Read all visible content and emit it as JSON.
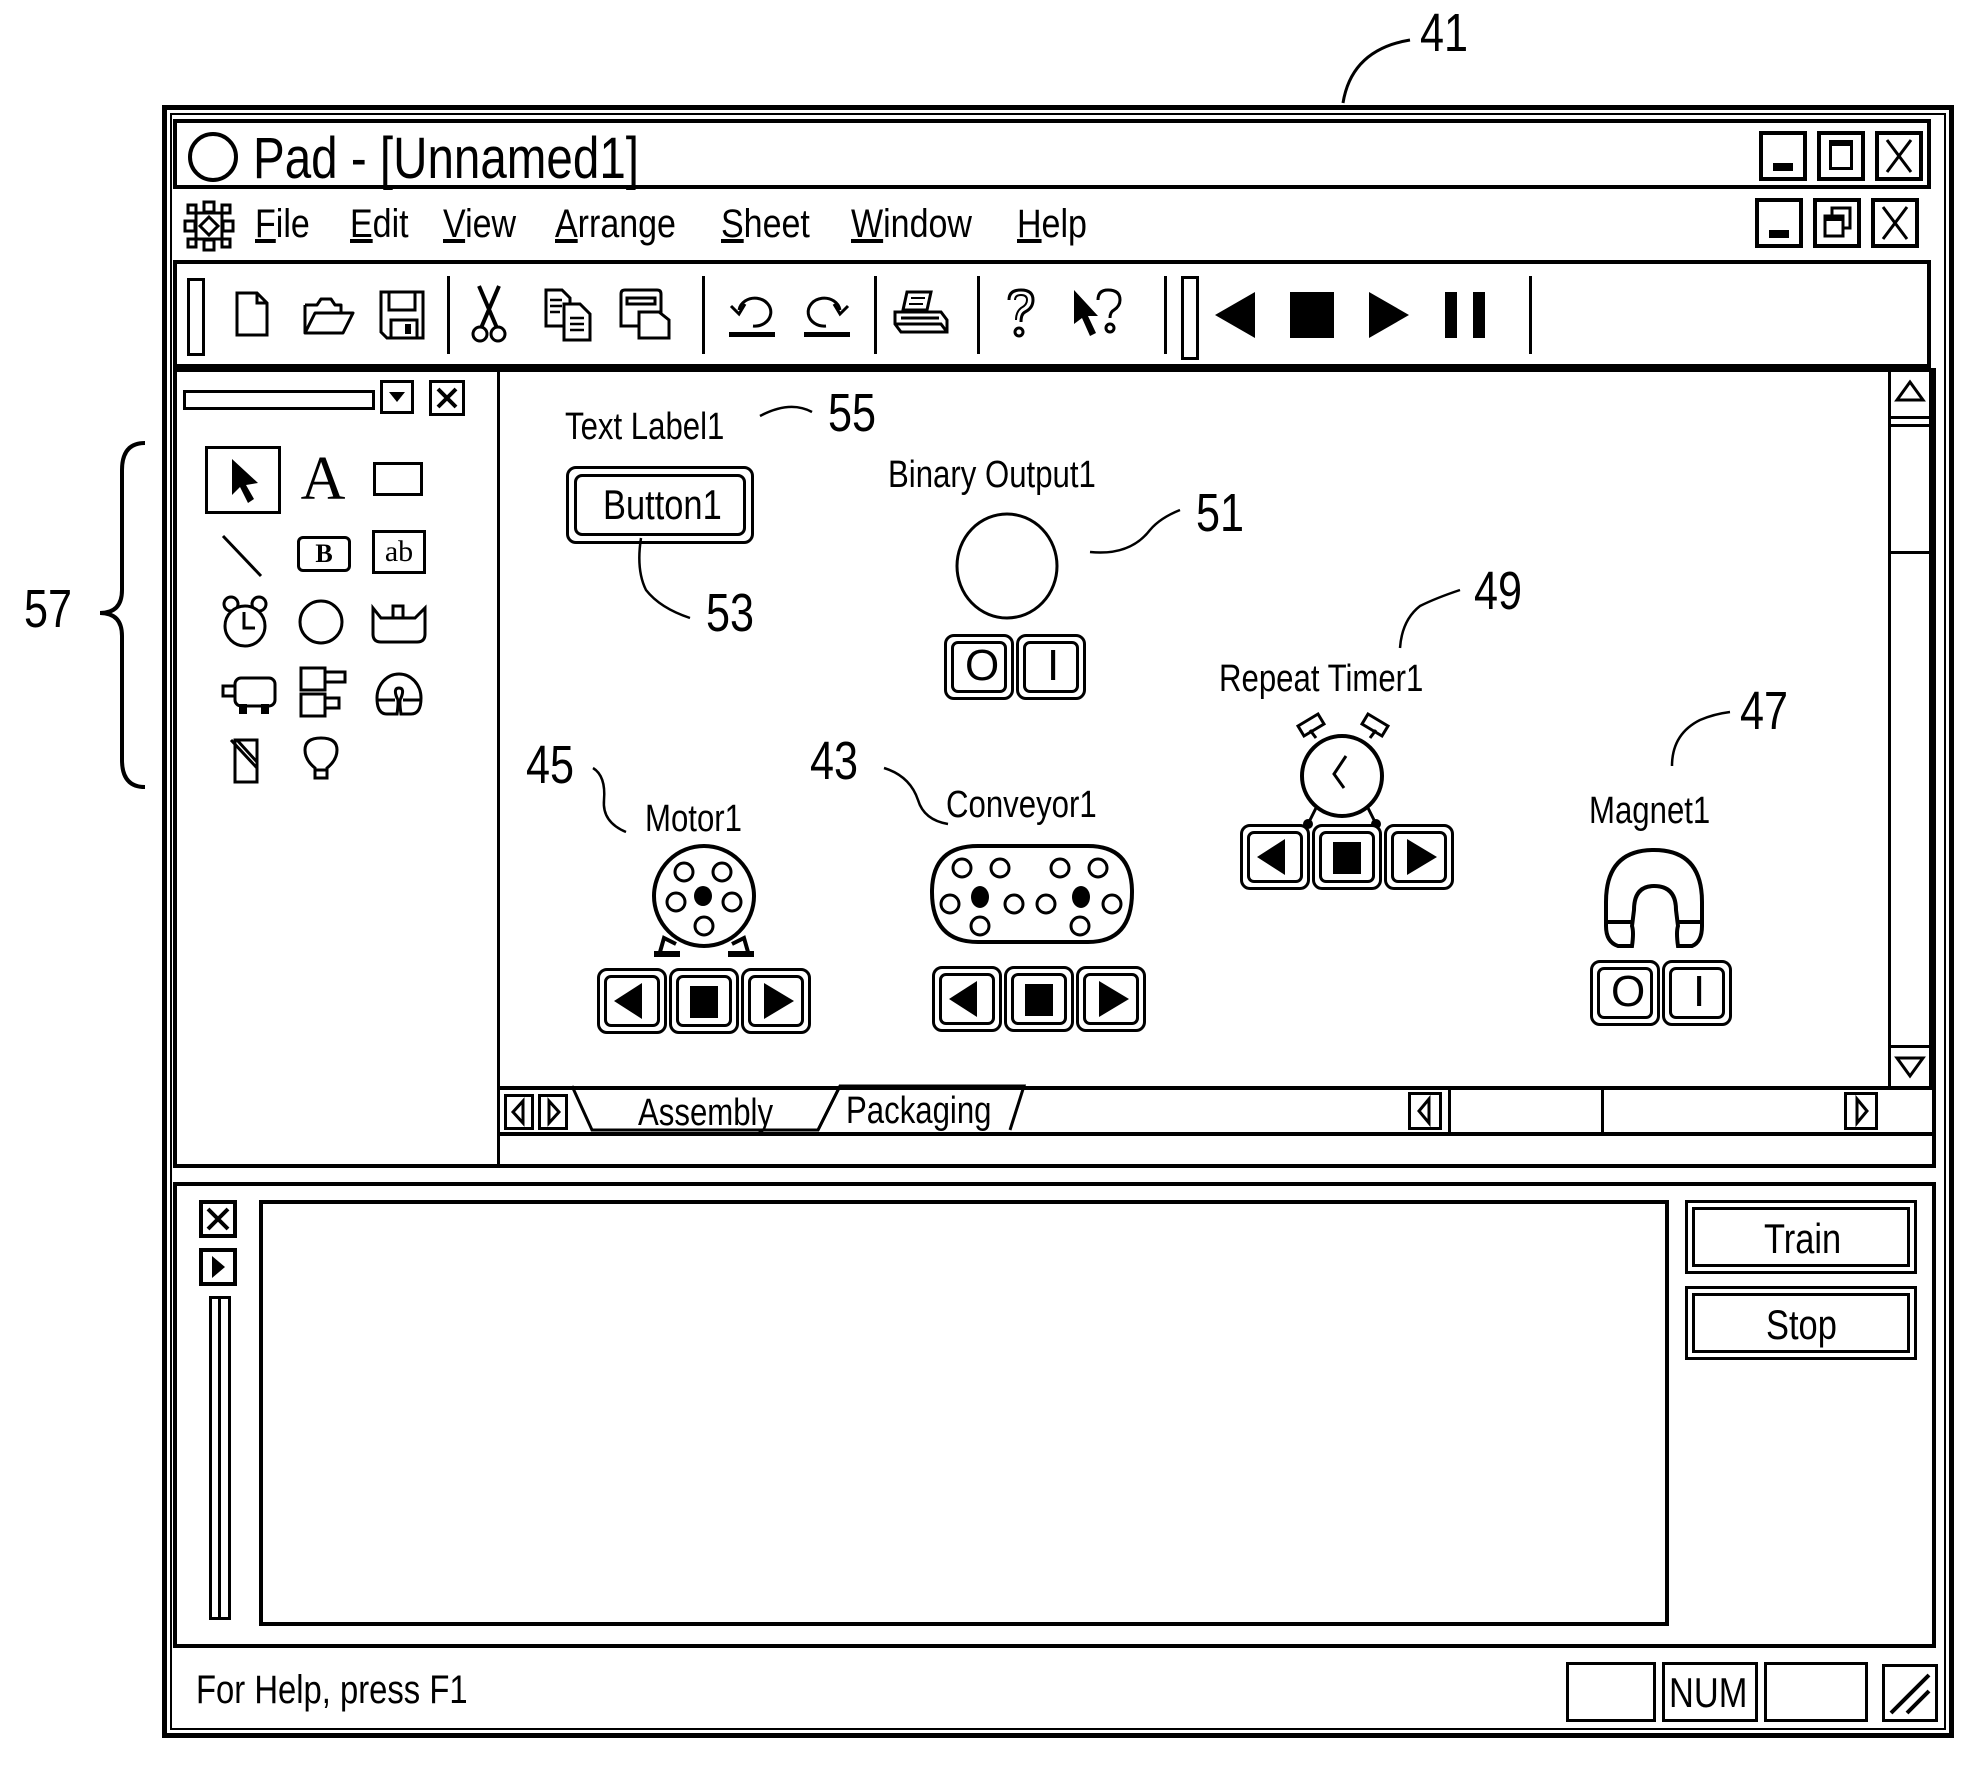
{
  "annotations": {
    "window_ref": "41",
    "toolbox_ref": "57",
    "text_label_ref": "55",
    "button_ref": "53",
    "binary_output_ref": "51",
    "repeat_timer_ref": "49",
    "magnet_ref": "47",
    "motor_ref": "45",
    "conveyor_ref": "43"
  },
  "window": {
    "title": "Pad - [Unnamed1]",
    "title_icon": "circle-icon",
    "controls": [
      "minimize-icon",
      "maximize-icon",
      "close-icon"
    ]
  },
  "menu": {
    "app_icon": "gear-icon",
    "items": [
      {
        "label": "File",
        "mnemonic": "F",
        "rest": "ile"
      },
      {
        "label": "Edit",
        "mnemonic": "E",
        "rest": "dit"
      },
      {
        "label": "View",
        "mnemonic": "V",
        "rest": "iew"
      },
      {
        "label": "Arrange",
        "mnemonic": "A",
        "rest": "rrange"
      },
      {
        "label": "Sheet",
        "mnemonic": "S",
        "rest": "heet"
      },
      {
        "label": "Window",
        "mnemonic": "W",
        "rest": "indow"
      },
      {
        "label": "Help",
        "mnemonic": "H",
        "rest": "elp"
      }
    ],
    "doc_controls": [
      "minimize-icon",
      "restore-icon",
      "close-icon"
    ]
  },
  "toolbar": {
    "groups": [
      [
        "new-file-icon",
        "open-folder-icon",
        "save-disk-icon"
      ],
      [
        "cut-scissors-icon",
        "copy-icon",
        "paste-icon"
      ],
      [
        "undo-icon",
        "redo-icon"
      ],
      [
        "print-icon"
      ],
      [
        "help-icon",
        "context-help-icon"
      ],
      [
        "run-back-icon",
        "stop-icon",
        "run-forward-icon",
        "pause-icon"
      ]
    ]
  },
  "toolbox": {
    "tools": [
      "pointer-tool",
      "text-tool",
      "rectangle-tool",
      "line-tool",
      "button-tool",
      "text-field-tool",
      "timer-tool",
      "circle-binary-output-tool",
      "conveyor-tool",
      "motor-tool",
      "cylinder-tool",
      "magnet-tool",
      "switch-tool",
      "light-bulb-tool"
    ],
    "text_tool_glyph": "A",
    "button_tool_glyph": "B",
    "field_tool_glyph": "ab",
    "selected": "pointer-tool"
  },
  "canvas": {
    "text_label": "Text Label1",
    "button_label": "Button1",
    "binary_output_label": "Binary Output1",
    "repeat_timer_label": "Repeat Timer1",
    "motor_label": "Motor1",
    "conveyor_label": "Conveyor1",
    "magnet_label": "Magnet1",
    "off_glyph": "O",
    "on_glyph": "I"
  },
  "sheet_tabs": [
    {
      "label": "Assembly",
      "active": true
    },
    {
      "label": "Packaging",
      "active": false
    }
  ],
  "output_panel": {
    "train_label": "Train",
    "stop_label": "Stop",
    "log_text": ""
  },
  "status_bar": {
    "help_text": "For Help, press F1",
    "indicators": [
      "",
      "NUM",
      ""
    ]
  }
}
